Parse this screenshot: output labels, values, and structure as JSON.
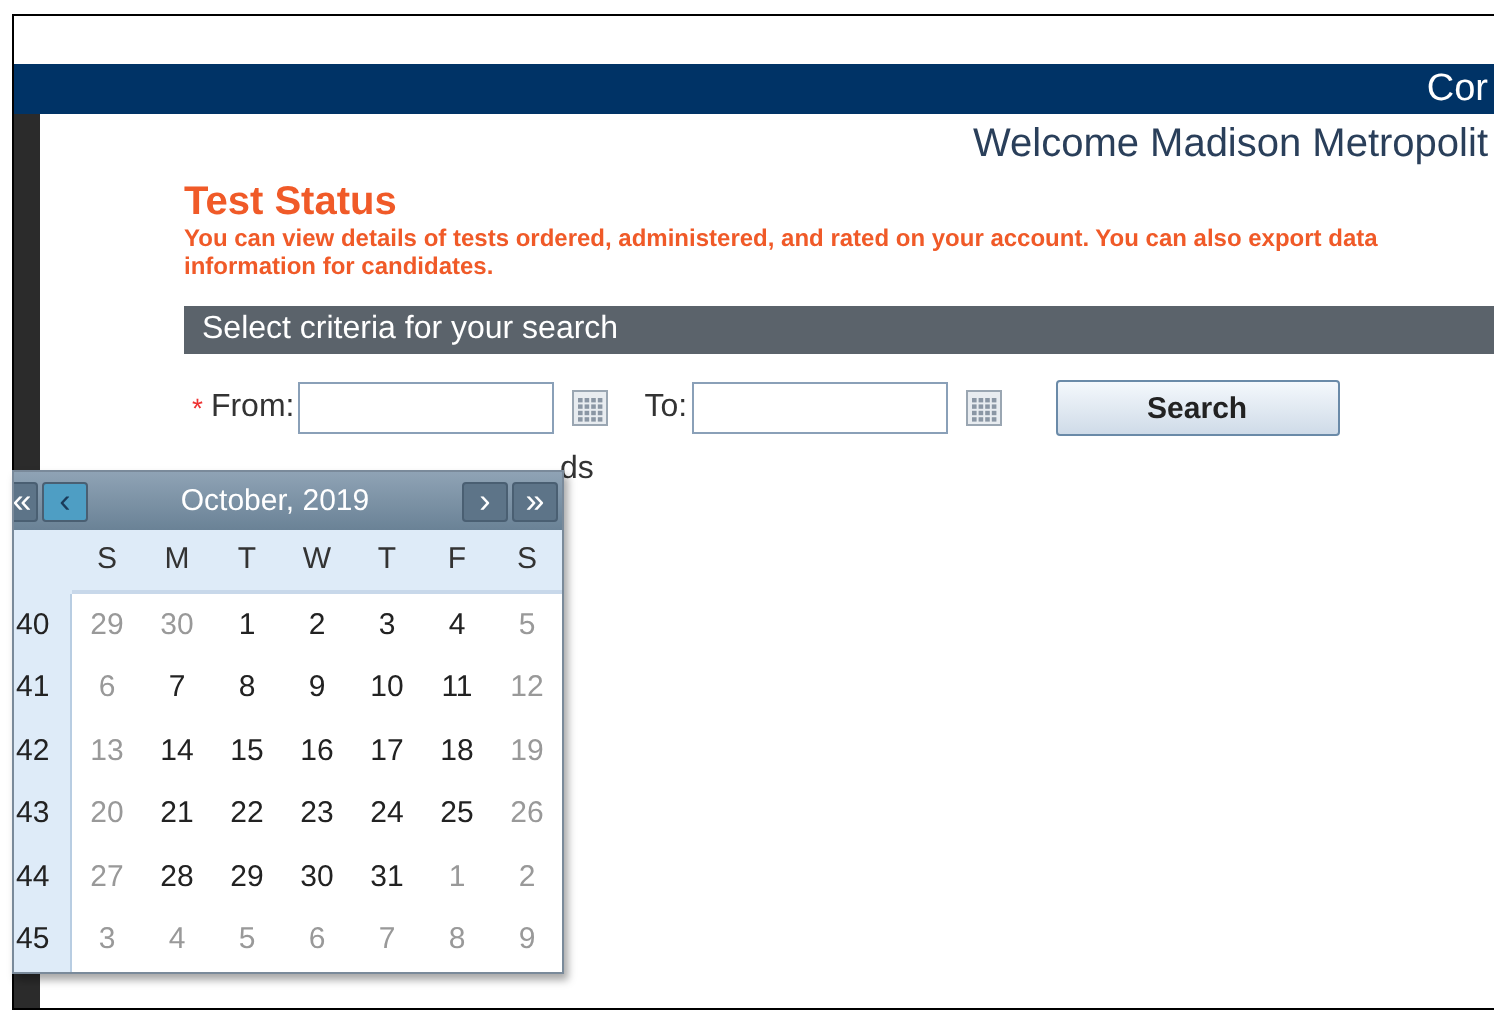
{
  "header": {
    "title": "Cor"
  },
  "welcome": "Welcome Madison Metropolit",
  "page": {
    "title": "Test Status",
    "description": "You can view details of tests ordered, administered, and rated on your account. You can also export data\ninformation for candidates."
  },
  "criteria": {
    "title": "Select criteria for your search",
    "from_required": "*",
    "from_label": "From:",
    "to_label": "To:",
    "search_button": "Search",
    "partial_label": "ds"
  },
  "calendar": {
    "first_button": "«",
    "prev_button": "‹",
    "next_button": "›",
    "last_button": "»",
    "title": "October, 2019",
    "weekdays": [
      "S",
      "M",
      "T",
      "W",
      "T",
      "F",
      "S"
    ],
    "weeks": [
      {
        "number": "40",
        "days": [
          {
            "label": "29",
            "dimmed": true
          },
          {
            "label": "30",
            "dimmed": true
          },
          {
            "label": "1",
            "dimmed": false
          },
          {
            "label": "2",
            "dimmed": false
          },
          {
            "label": "3",
            "dimmed": false
          },
          {
            "label": "4",
            "dimmed": false
          },
          {
            "label": "5",
            "dimmed": true
          }
        ]
      },
      {
        "number": "41",
        "days": [
          {
            "label": "6",
            "dimmed": true
          },
          {
            "label": "7",
            "dimmed": false
          },
          {
            "label": "8",
            "dimmed": false
          },
          {
            "label": "9",
            "dimmed": false
          },
          {
            "label": "10",
            "dimmed": false
          },
          {
            "label": "11",
            "dimmed": false
          },
          {
            "label": "12",
            "dimmed": true
          }
        ]
      },
      {
        "number": "42",
        "days": [
          {
            "label": "13",
            "dimmed": true
          },
          {
            "label": "14",
            "dimmed": false
          },
          {
            "label": "15",
            "dimmed": false
          },
          {
            "label": "16",
            "dimmed": false
          },
          {
            "label": "17",
            "dimmed": false
          },
          {
            "label": "18",
            "dimmed": false
          },
          {
            "label": "19",
            "dimmed": true
          }
        ]
      },
      {
        "number": "43",
        "days": [
          {
            "label": "20",
            "dimmed": true
          },
          {
            "label": "21",
            "dimmed": false
          },
          {
            "label": "22",
            "dimmed": false
          },
          {
            "label": "23",
            "dimmed": false
          },
          {
            "label": "24",
            "dimmed": false
          },
          {
            "label": "25",
            "dimmed": false
          },
          {
            "label": "26",
            "dimmed": true
          }
        ]
      },
      {
        "number": "44",
        "days": [
          {
            "label": "27",
            "dimmed": true
          },
          {
            "label": "28",
            "dimmed": false
          },
          {
            "label": "29",
            "dimmed": false
          },
          {
            "label": "30",
            "dimmed": false
          },
          {
            "label": "31",
            "dimmed": false
          },
          {
            "label": "1",
            "dimmed": true
          },
          {
            "label": "2",
            "dimmed": true
          }
        ]
      },
      {
        "number": "45",
        "days": [
          {
            "label": "3",
            "dimmed": true
          },
          {
            "label": "4",
            "dimmed": true
          },
          {
            "label": "5",
            "dimmed": true
          },
          {
            "label": "6",
            "dimmed": true
          },
          {
            "label": "7",
            "dimmed": true
          },
          {
            "label": "8",
            "dimmed": true
          },
          {
            "label": "9",
            "dimmed": true
          }
        ]
      }
    ]
  }
}
